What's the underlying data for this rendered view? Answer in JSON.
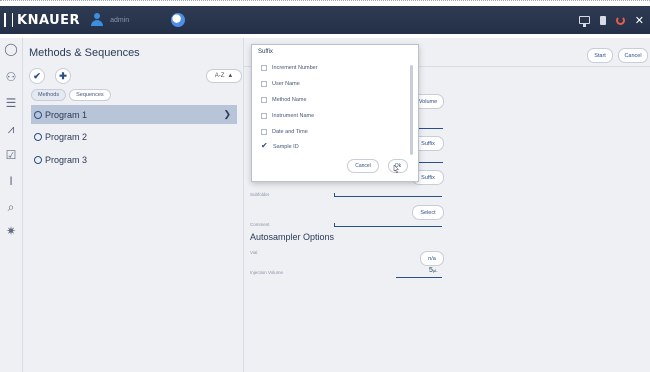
{
  "app": {
    "brand": "KNAUER",
    "user": "admin"
  },
  "colors": {
    "topbar": "#2f3b52",
    "accent": "#2b4f8a",
    "selected_row": "#b8c4d8",
    "power": "#e85a4a"
  },
  "icons": {
    "rail": [
      "circle-icon",
      "users-icon",
      "list-icon",
      "chart-icon",
      "check-list-icon",
      "text-cursor-icon",
      "search-doc-icon",
      "gear-icon"
    ]
  },
  "left": {
    "title": "Methods & Sequences",
    "sort_label": "A-Z",
    "tabs": [
      "Methods",
      "Sequences"
    ],
    "programs": [
      {
        "label": "Program 1",
        "selected": true
      },
      {
        "label": "Program 2",
        "selected": false
      },
      {
        "label": "Program 3",
        "selected": false
      }
    ]
  },
  "main": {
    "start": "Start",
    "cancel": "Cancel",
    "volume_btn": "Volume",
    "suffix_btn_1": "Suffix",
    "suffix_btn_2": "Suffix",
    "select_btn": "Select",
    "subfolder_label": "Subfolder",
    "comment_label": "Comment",
    "autosampler_title": "Autosampler Options",
    "vial_label": "Vial",
    "vial_value": "n/a",
    "injection_label": "Injection Volume",
    "injection_value": "5",
    "injection_unit": "µL"
  },
  "dialog": {
    "title": "Suffix",
    "options": [
      {
        "label": "Increment Number",
        "checked": false
      },
      {
        "label": "User Name",
        "checked": false
      },
      {
        "label": "Method Name",
        "checked": false
      },
      {
        "label": "Instrument Name",
        "checked": false
      },
      {
        "label": "Date and Time",
        "checked": false
      },
      {
        "label": "Sample ID",
        "checked": true
      }
    ],
    "cancel": "Cancel",
    "ok": "Ok"
  }
}
